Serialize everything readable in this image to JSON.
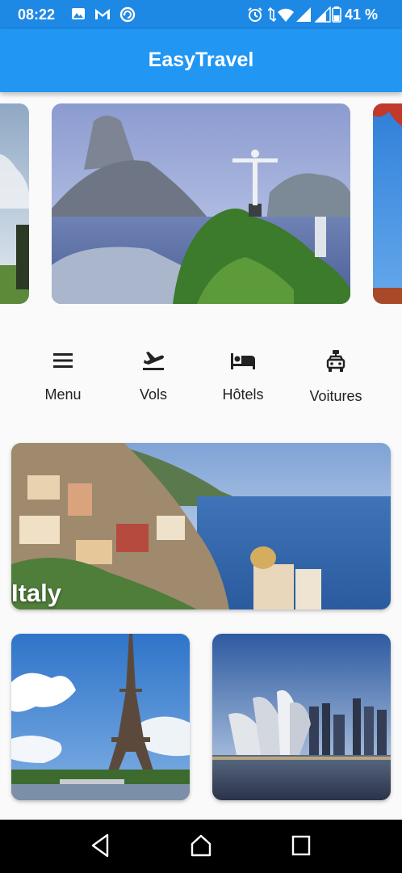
{
  "status_bar": {
    "time": "08:22",
    "battery": "41 %",
    "icons_left": [
      "image-icon",
      "gmail-icon",
      "sync-icon"
    ],
    "icons_right": [
      "alarm-icon",
      "wifi-icon",
      "signal-icon",
      "signal-icon",
      "battery-icon"
    ]
  },
  "app_bar": {
    "title": "EasyTravel"
  },
  "categories": [
    {
      "label": "Menu",
      "icon": "menu-icon"
    },
    {
      "label": "Vols",
      "icon": "flight-departure-icon"
    },
    {
      "label": "Hôtels",
      "icon": "bed-icon"
    },
    {
      "label": "Voitures",
      "icon": "car-icon"
    }
  ],
  "destinations": [
    {
      "label": "Italy"
    },
    {
      "label": ""
    },
    {
      "label": ""
    }
  ],
  "colors": {
    "primary": "#2196f3",
    "status_bar": "#1e88e5",
    "background": "#fafafa"
  }
}
